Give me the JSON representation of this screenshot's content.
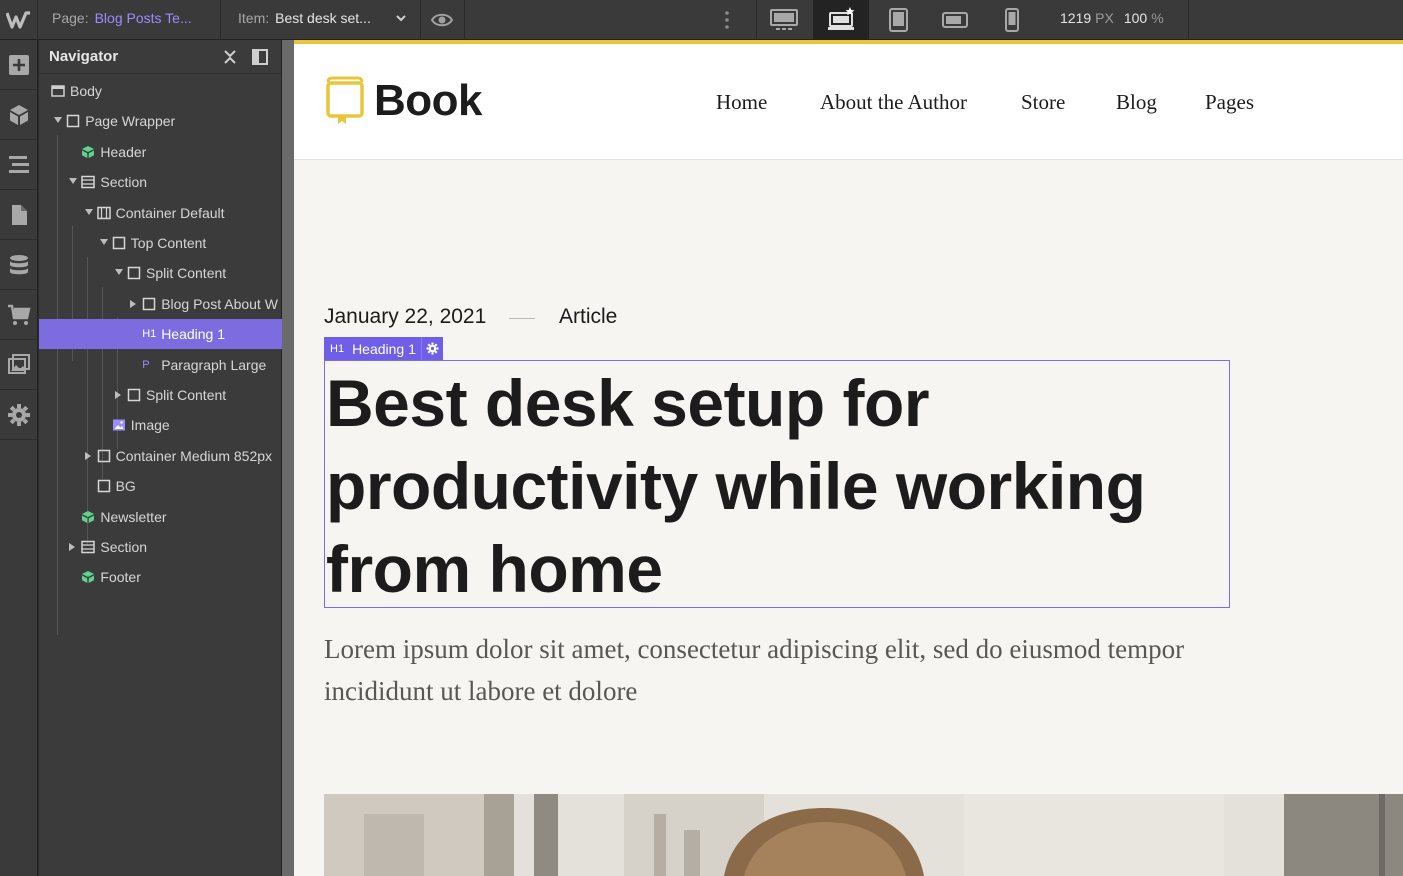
{
  "topbar": {
    "page_label": "Page:",
    "page_value": "Blog Posts Te...",
    "item_label": "Item:",
    "item_value": "Best desk set...",
    "canvas_width": "1219",
    "canvas_width_unit": "PX",
    "zoom": "100",
    "zoom_unit": "%",
    "breakpoints": [
      {
        "name": "desktop-large",
        "active": false
      },
      {
        "name": "desktop-base",
        "active": true
      },
      {
        "name": "tablet",
        "active": false
      },
      {
        "name": "mobile-landscape",
        "active": false
      },
      {
        "name": "mobile-portrait",
        "active": false
      }
    ]
  },
  "rail": {
    "icons": [
      "add-icon",
      "components-icon",
      "navigator-icon",
      "pages-icon",
      "cms-icon",
      "ecommerce-icon",
      "assets-icon",
      "settings-icon"
    ]
  },
  "navigator": {
    "title": "Navigator",
    "nodes": [
      {
        "label": "Body",
        "type": "body",
        "depth": 0,
        "caret": "none",
        "selected": false
      },
      {
        "label": "Page Wrapper",
        "type": "div",
        "depth": 1,
        "caret": "down",
        "selected": false
      },
      {
        "label": "Header",
        "type": "symbol",
        "depth": 2,
        "caret": "none",
        "selected": false
      },
      {
        "label": "Section",
        "type": "section",
        "depth": 2,
        "caret": "down",
        "selected": false
      },
      {
        "label": "Container Default",
        "type": "container",
        "depth": 3,
        "caret": "down",
        "selected": false
      },
      {
        "label": "Top Content",
        "type": "div",
        "depth": 4,
        "caret": "down",
        "selected": false
      },
      {
        "label": "Split Content",
        "type": "div",
        "depth": 5,
        "caret": "down",
        "selected": false
      },
      {
        "label": "Blog Post About W",
        "type": "div",
        "depth": 6,
        "caret": "right",
        "selected": false
      },
      {
        "label": "Heading 1",
        "type": "h1",
        "depth": 6,
        "caret": "none",
        "selected": true
      },
      {
        "label": "Paragraph Large",
        "type": "p",
        "depth": 6,
        "caret": "none",
        "selected": false
      },
      {
        "label": "Split Content",
        "type": "div",
        "depth": 5,
        "caret": "right",
        "selected": false
      },
      {
        "label": "Image",
        "type": "image",
        "depth": 4,
        "caret": "none",
        "selected": false
      },
      {
        "label": "Container Medium 852px",
        "type": "div",
        "depth": 3,
        "caret": "right",
        "selected": false
      },
      {
        "label": "BG",
        "type": "div",
        "depth": 3,
        "caret": "none",
        "selected": false
      },
      {
        "label": "Newsletter",
        "type": "symbol",
        "depth": 2,
        "caret": "none",
        "selected": false
      },
      {
        "label": "Section",
        "type": "section",
        "depth": 2,
        "caret": "right",
        "selected": false
      },
      {
        "label": "Footer",
        "type": "symbol",
        "depth": 2,
        "caret": "none",
        "selected": false
      }
    ]
  },
  "site": {
    "brand": "Book",
    "menu": [
      "Home",
      "About the Author",
      "Store",
      "Blog",
      "Pages"
    ],
    "post_date": "January 22, 2021",
    "post_type": "Article",
    "selection_tag": "Heading 1",
    "selection_tag_mark": "H1",
    "headline": "Best desk setup for productivity while working from home",
    "lead": "Lorem ipsum dolor sit amet, consectetur adipiscing elit, sed do eiusmod tempor incididunt ut labore et dolore"
  },
  "colors": {
    "accent": "#7d6be0",
    "brand_yellow": "#e8c53a",
    "symbol_green": "#5fd38d",
    "link_purple": "#9c8cff"
  }
}
